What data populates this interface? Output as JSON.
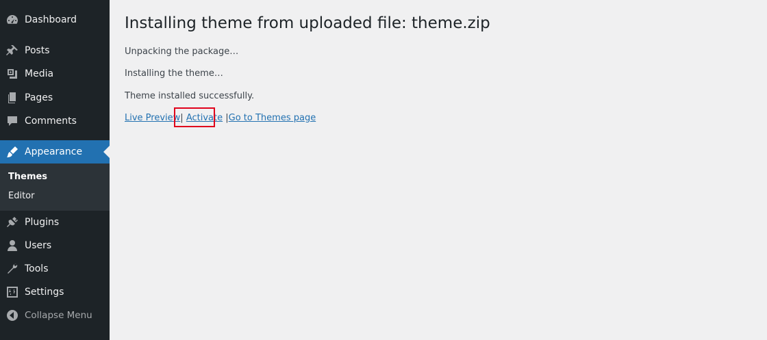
{
  "sidebar": {
    "items": [
      {
        "label": "Dashboard",
        "icon": "dashboard-icon"
      },
      {
        "label": "Posts",
        "icon": "pin-icon"
      },
      {
        "label": "Media",
        "icon": "media-icon"
      },
      {
        "label": "Pages",
        "icon": "pages-icon"
      },
      {
        "label": "Comments",
        "icon": "comment-icon"
      },
      {
        "label": "Appearance",
        "icon": "brush-icon",
        "current": true
      },
      {
        "label": "Plugins",
        "icon": "plugin-icon"
      },
      {
        "label": "Users",
        "icon": "user-icon"
      },
      {
        "label": "Tools",
        "icon": "wrench-icon"
      },
      {
        "label": "Settings",
        "icon": "settings-icon"
      }
    ],
    "submenu": [
      {
        "label": "Themes",
        "current": true
      },
      {
        "label": "Editor"
      }
    ],
    "collapse_label": "Collapse Menu"
  },
  "main": {
    "title": "Installing theme from uploaded file: theme.zip",
    "messages": [
      "Unpacking the package…",
      "Installing the theme…",
      "Theme installed successfully."
    ],
    "actions": {
      "live_preview": "Live Preview",
      "activate": "Activate",
      "themes_page": "Go to Themes page",
      "separator": "|"
    }
  },
  "colors": {
    "sidebar_bg": "#1d2327",
    "accent": "#2271b1",
    "highlight_box": "#e0001b"
  }
}
